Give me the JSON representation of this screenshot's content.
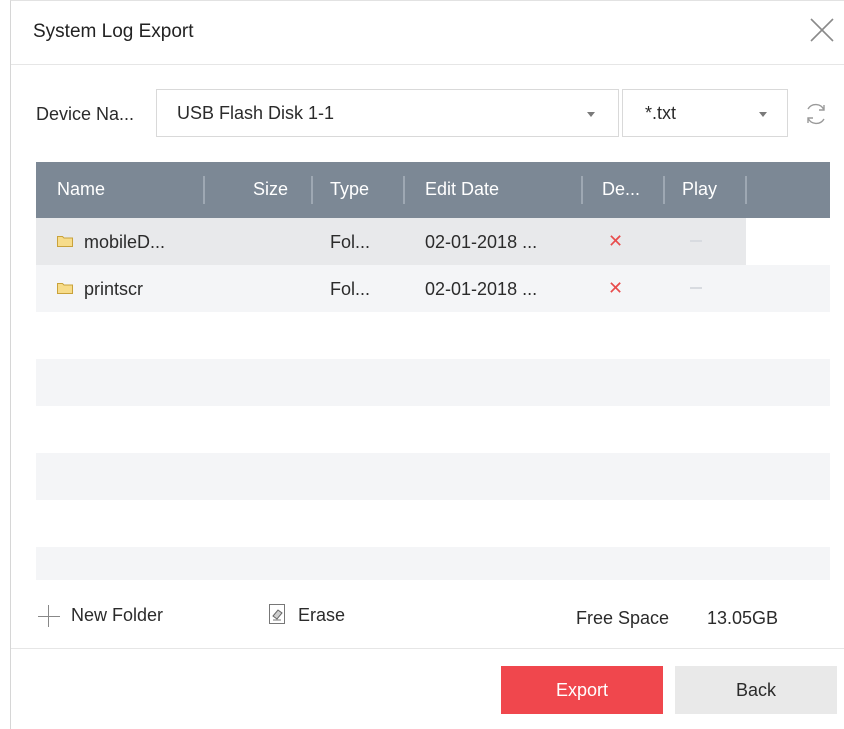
{
  "dialog": {
    "title": "System Log Export"
  },
  "device": {
    "label": "Device Na...",
    "selected": "USB Flash Disk 1-1"
  },
  "filter": {
    "selected": "*.txt"
  },
  "table": {
    "headers": {
      "name": "Name",
      "size": "Size",
      "type": "Type",
      "edit_date": "Edit Date",
      "delete": "De...",
      "play": "Play"
    },
    "rows": [
      {
        "name": "mobileD...",
        "size": "",
        "type": "Fol...",
        "edit_date": "02-01-2018 ..."
      },
      {
        "name": "printscr",
        "size": "",
        "type": "Fol...",
        "edit_date": "02-01-2018 ..."
      }
    ],
    "delete_glyph": "✕"
  },
  "tools": {
    "new_folder_label": "New Folder",
    "erase_label": "Erase",
    "free_space_label": "Free Space",
    "free_space_value": "13.05GB"
  },
  "buttons": {
    "export_label": "Export",
    "back_label": "Back"
  },
  "colors": {
    "header_bg": "#7c8895",
    "accent_red": "#f0474d",
    "folder_yellow": "#f2c94c"
  },
  "icons": [
    "close-icon",
    "chevron-down-icon",
    "refresh-icon",
    "folder-icon",
    "delete-icon",
    "plus-icon",
    "erase-icon"
  ]
}
